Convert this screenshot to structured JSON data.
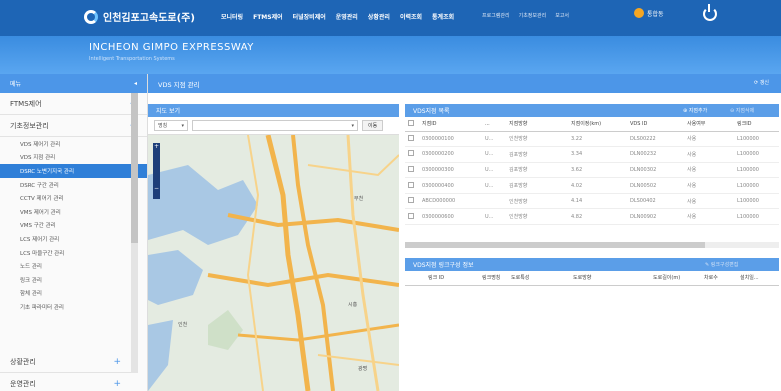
{
  "header": {
    "logo_text": "인천김포고속도로(주)",
    "main_nav": [
      "모니터링",
      "FTMS제어",
      "터널장비제어",
      "운영관리",
      "상황관리",
      "이력조회",
      "통계조회"
    ],
    "sub_nav": [
      "프로그램관리",
      "기초정보관리",
      "보고서"
    ],
    "user_label": "통합동"
  },
  "banner": {
    "title": "INCHEON GIMPO EXPRESSWAY",
    "subtitle": "Intelligent Transportation Systems"
  },
  "sidebar": {
    "head": "메뉴",
    "head_toggle": "◂",
    "sections": [
      {
        "label": "FTMS제어",
        "toggle": "+"
      },
      {
        "label": "기초정보관리",
        "toggle": "−"
      }
    ],
    "items": [
      "VDS 제어기 관리",
      "VDS 지점 관리",
      "DSRC 노변기지국 관리",
      "DSRC 구간 관리",
      "CCTV 제어기 관리",
      "VMS 제어기 관리",
      "VMS 구간 관리",
      "LCS 제어기 관리",
      "LCS 마을구간 관리",
      "노드 관리",
      "링크 관리",
      "함체 관리",
      "기초 파라미터 관리"
    ],
    "active_index": 2,
    "footer_sections": [
      {
        "label": "상황관리",
        "toggle": "+"
      },
      {
        "label": "운영관리",
        "toggle": "+"
      }
    ]
  },
  "page": {
    "title": "VDS 지점 관리",
    "refresh_label": "갱신"
  },
  "map_panel": {
    "title": "지도 보기",
    "filter_select": "명칭",
    "search_select": "",
    "move_button": "이동",
    "zoom_in": "+",
    "zoom_out": "−",
    "labels": [
      "인천",
      "시흥",
      "부천",
      "광명"
    ]
  },
  "vds_list": {
    "title": "VDS지점 목록",
    "add_button": "지점추가",
    "delete_button": "지점삭제",
    "columns": [
      "지점ID",
      "...",
      "지점방향",
      "지점이정(km)",
      "VDS ID",
      "사용여부",
      "링크ID"
    ],
    "rows": [
      [
        "0300000100",
        "U...",
        "인천방향",
        "3.22",
        "DLS00222",
        "사용",
        "L100000"
      ],
      [
        "0300000200",
        "U...",
        "김포방향",
        "3.34",
        "DLN00232",
        "사용",
        "L100000"
      ],
      [
        "0300000300",
        "U...",
        "김포방향",
        "3.62",
        "DLN00302",
        "사용",
        "L100000"
      ],
      [
        "0300000400",
        "U...",
        "김포방향",
        "4.02",
        "DLN00502",
        "사용",
        "L100000"
      ],
      [
        "ABCD000000",
        "",
        "인천방향",
        "4.14",
        "DLS00402",
        "사용",
        "L100000"
      ],
      [
        "0300000600",
        "U...",
        "인천방향",
        "4.82",
        "DLN00902",
        "사용",
        "L100000"
      ]
    ]
  },
  "link_info": {
    "title": "VDS지점 링크구성 정보",
    "edit_button": "링크구성편집",
    "columns": [
      "링크 ID",
      "링크명칭",
      "도로특성",
      "도로방향",
      "도로길이(m)",
      "차로수",
      "설치일..."
    ]
  },
  "colors": {
    "topbar": "#1e65b5",
    "accent": "#4c96e8",
    "active": "#2f7fd8"
  }
}
